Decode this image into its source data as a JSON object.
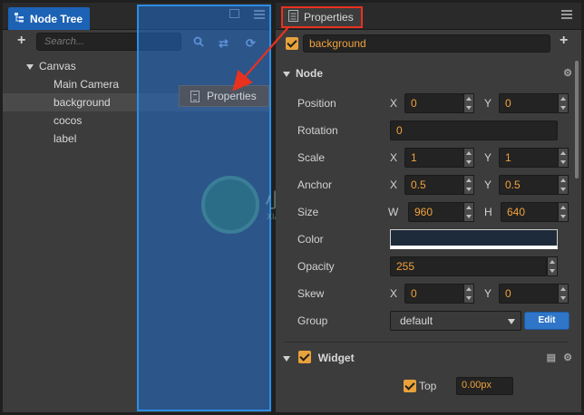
{
  "colors": {
    "accent": "#1c62b5",
    "value_orange": "#f0a23c",
    "highlight_red": "#e8311f",
    "drop_overlay": "#2b8ee6"
  },
  "node_tree": {
    "tab_label": "Node Tree",
    "search_placeholder": "Search...",
    "items": [
      {
        "label": "Canvas",
        "expanded": true
      },
      {
        "label": "Main Camera"
      },
      {
        "label": "background",
        "selected": true
      },
      {
        "label": "cocos"
      },
      {
        "label": "label"
      }
    ]
  },
  "drag_ghost": {
    "label": "Properties"
  },
  "watermark": {
    "text": "小牛知识库",
    "subtext": "XIAO NIU ZHI SHI KU"
  },
  "properties": {
    "tab_label": "Properties",
    "node_name": "background",
    "node_section": "Node",
    "fields": {
      "position": {
        "label": "Position",
        "x_axis": "X",
        "x": "0",
        "y_axis": "Y",
        "y": "0"
      },
      "rotation": {
        "label": "Rotation",
        "value": "0"
      },
      "scale": {
        "label": "Scale",
        "x_axis": "X",
        "x": "1",
        "y_axis": "Y",
        "y": "1"
      },
      "anchor": {
        "label": "Anchor",
        "x_axis": "X",
        "x": "0.5",
        "y_axis": "Y",
        "y": "0.5"
      },
      "size": {
        "label": "Size",
        "w_axis": "W",
        "w": "960",
        "h_axis": "H",
        "h": "640"
      },
      "color": {
        "label": "Color",
        "value": "#1e2b3a"
      },
      "opacity": {
        "label": "Opacity",
        "value": "255"
      },
      "skew": {
        "label": "Skew",
        "x_axis": "X",
        "x": "0",
        "y_axis": "Y",
        "y": "0"
      },
      "group": {
        "label": "Group",
        "value": "default",
        "edit_label": "Edit"
      }
    },
    "widget_section": "Widget",
    "widget": {
      "top_label": "Top",
      "top_value": "0.00px"
    }
  }
}
